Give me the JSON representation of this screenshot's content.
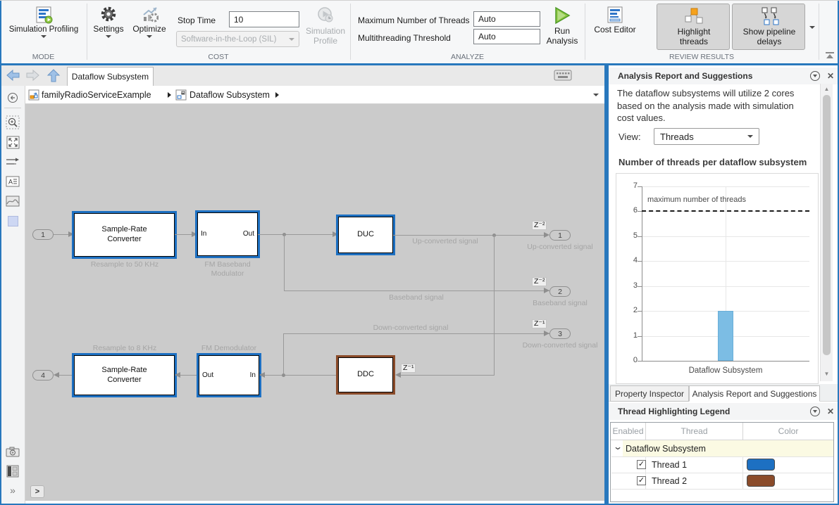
{
  "icons": {
    "close": "✕",
    "more_chevrons": "»",
    "console_prompt": ">",
    "scroll_up": "▲",
    "scroll_down": "▼",
    "group_chevron": "⌄"
  },
  "colors": {
    "thread1": "#1d70c2",
    "thread2": "#8a4b2a",
    "bar": "#7cbde4",
    "frame": "#2878bd"
  },
  "ribbon": {
    "mode": {
      "section": "MODE",
      "simulation_profiling": "Simulation Profiling"
    },
    "cost": {
      "section": "COST",
      "settings": "Settings",
      "optimize": "Optimize",
      "stop_time_label": "Stop Time",
      "stop_time_value": "10",
      "sil_value": "Software-in-the-Loop (SIL)",
      "simulation_profile": "Simulation Profile"
    },
    "analyze": {
      "section": "ANALYZE",
      "max_threads_label": "Maximum Number of Threads",
      "max_threads_value": "Auto",
      "threshold_label": "Multithreading Threshold",
      "threshold_value": "Auto",
      "run_analysis": "Run Analysis"
    },
    "review": {
      "section": "REVIEW RESULTS",
      "cost_editor": "Cost Editor",
      "highlight_threads": "Highlight threads",
      "show_pipeline_delays": "Show pipeline delays"
    }
  },
  "navigation": {
    "tab": "Dataflow Subsystem",
    "breadcrumb": [
      "familyRadioServiceExample",
      "Dataflow Subsystem"
    ]
  },
  "canvas": {
    "blocks": {
      "src1": {
        "label": "Sample-Rate Converter",
        "caption": "Resample to 50 KHz"
      },
      "fm_mod": {
        "in": "In",
        "out": "Out",
        "caption": "FM Baseband Modulator"
      },
      "duc": {
        "label": "DUC"
      },
      "src2": {
        "label": "Sample-Rate Converter",
        "caption": "Resample to 8 KHz"
      },
      "fm_demod": {
        "out": "Out",
        "in": "In",
        "caption": "FM Demodulator"
      },
      "ddc": {
        "label": "DDC",
        "input_delay": "Z⁻¹"
      }
    },
    "ports": {
      "in1": "1",
      "out1": {
        "num": "1",
        "delay": "Z⁻²",
        "label": "Up-converted signal"
      },
      "out2": {
        "num": "2",
        "delay": "Z⁻²",
        "label": "Baseband signal"
      },
      "out3": {
        "num": "3",
        "delay": "Z⁻¹",
        "label": "Down-converted signal"
      },
      "out4": "4"
    },
    "line_labels": {
      "up": "Up-converted signal",
      "baseband": "Baseband signal",
      "down": "Down-converted signal"
    }
  },
  "report": {
    "title": "Analysis Report and Suggestions",
    "summary": "The dataflow subsystems will utilize 2 cores based on the analysis made with simulation cost values.",
    "view_label": "View:",
    "view_value": "Threads"
  },
  "chart_data": {
    "type": "bar",
    "title": "Number of threads per dataflow subsystem",
    "categories": [
      "Dataflow Subsystem"
    ],
    "values": [
      2
    ],
    "ylim": [
      0,
      7
    ],
    "yticks": [
      0,
      1,
      2,
      3,
      4,
      5,
      6,
      7
    ],
    "grid": true,
    "bar_color": "#7cbde4",
    "reference_line": {
      "value": 6,
      "label": "maximum number of threads",
      "style": "dashed"
    }
  },
  "dock": {
    "tabs": [
      "Property Inspector",
      "Analysis Report and Suggestions"
    ],
    "legend": {
      "title": "Thread Highlighting Legend",
      "columns": [
        "Enabled",
        "Thread",
        "Color"
      ],
      "group": "Dataflow Subsystem",
      "rows": [
        {
          "name": "Thread 1",
          "enabled": true,
          "color": "#1d70c2"
        },
        {
          "name": "Thread 2",
          "enabled": true,
          "color": "#8a4b2a"
        }
      ]
    }
  }
}
